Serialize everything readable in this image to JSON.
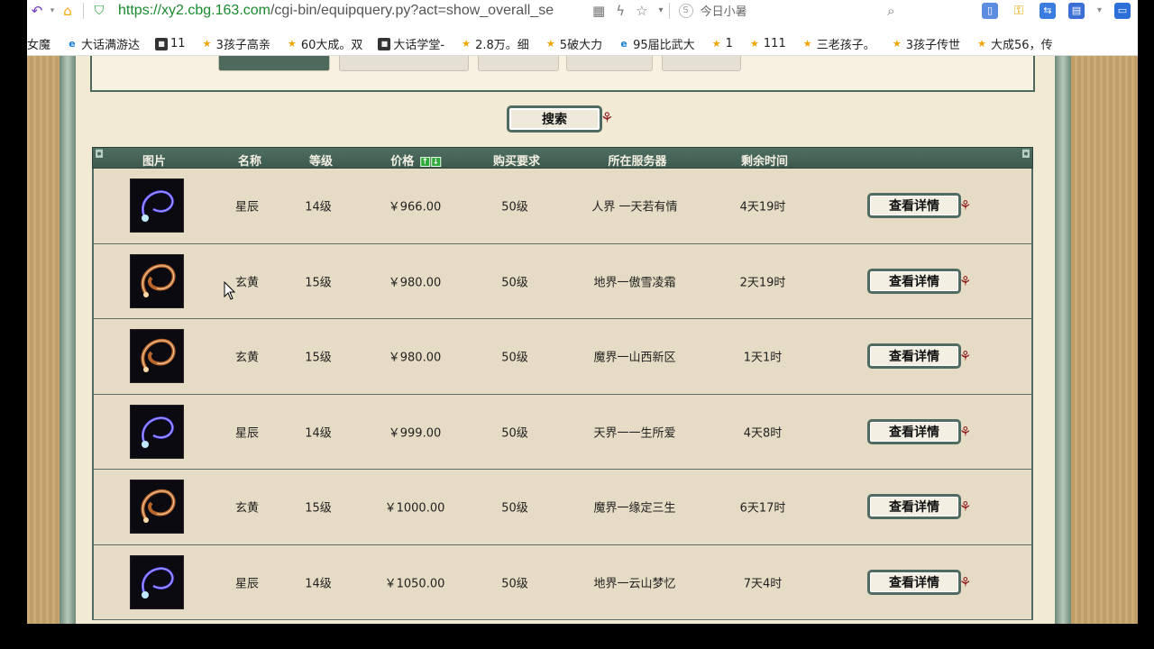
{
  "browser": {
    "url_https": "https://",
    "url_host": "xy2.cbg.163.com",
    "url_path": "/cgi-bin/equipquery.py?act=show_overall_se",
    "search_hint": "今日小暑"
  },
  "bookmarks": [
    {
      "label": "女魔",
      "icon": "star"
    },
    {
      "label": "大话满游达",
      "icon": "ie"
    },
    {
      "label": "11",
      "icon": "dark"
    },
    {
      "label": "3孩子高亲",
      "icon": "star"
    },
    {
      "label": "60大成。双",
      "icon": "star"
    },
    {
      "label": "大话学堂-",
      "icon": "dark"
    },
    {
      "label": "2.8万。细",
      "icon": "star"
    },
    {
      "label": "5破大力",
      "icon": "star"
    },
    {
      "label": "95届比武大",
      "icon": "ie"
    },
    {
      "label": "1",
      "icon": "star"
    },
    {
      "label": "111",
      "icon": "star"
    },
    {
      "label": "三老孩子。",
      "icon": "star"
    },
    {
      "label": "3孩子传世",
      "icon": "star"
    },
    {
      "label": "大成56，传",
      "icon": "star"
    }
  ],
  "search_button": "搜索",
  "table": {
    "headers": {
      "image": "图片",
      "name": "名称",
      "level": "等级",
      "price": "价格",
      "requirement": "购买要求",
      "server": "所在服务器",
      "remaining": "剩余时间"
    },
    "sort_up": "↑",
    "sort_down": "↓",
    "rows": [
      {
        "kind": "blue",
        "name": "星辰",
        "level": "14级",
        "price": "￥966.00",
        "req": "50级",
        "server": "人界 一天若有情",
        "remaining": "4天19时",
        "action": "查看详情"
      },
      {
        "kind": "gold",
        "name": "玄黄",
        "level": "15级",
        "price": "￥980.00",
        "req": "50级",
        "server": "地界一傲雪凌霜",
        "remaining": "2天19时",
        "action": "查看详情"
      },
      {
        "kind": "gold",
        "name": "玄黄",
        "level": "15级",
        "price": "￥980.00",
        "req": "50级",
        "server": "魔界一山西新区",
        "remaining": "1天1时",
        "action": "查看详情"
      },
      {
        "kind": "blue",
        "name": "星辰",
        "level": "14级",
        "price": "￥999.00",
        "req": "50级",
        "server": "天界一一生所爱",
        "remaining": "4天8时",
        "action": "查看详情"
      },
      {
        "kind": "gold",
        "name": "玄黄",
        "level": "15级",
        "price": "￥1000.00",
        "req": "50级",
        "server": "魔界一缘定三生",
        "remaining": "6天17时",
        "action": "查看详情"
      },
      {
        "kind": "blue",
        "name": "星辰",
        "level": "14级",
        "price": "￥1050.00",
        "req": "50级",
        "server": "地界一云山梦忆",
        "remaining": "7天4时",
        "action": "查看详情"
      }
    ]
  },
  "colors": {
    "frame_green": "#4f6b62",
    "paper": "#f3ead6",
    "row_bg": "#e6dbc4",
    "ribbon_red": "#8b1a1a"
  }
}
